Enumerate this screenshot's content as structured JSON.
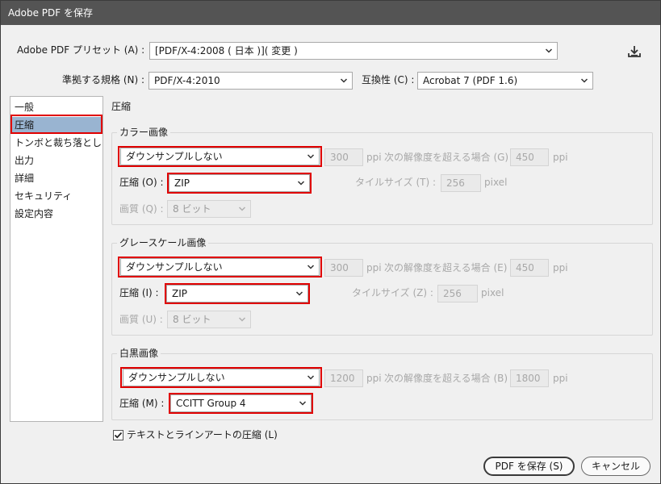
{
  "window": {
    "title": "Adobe PDF を保存"
  },
  "preset": {
    "label": "Adobe PDF プリセット (A) :",
    "value": "[PDF/X-4:2008 ( 日本 )]( 変更 )"
  },
  "standard": {
    "label": "準拠する規格 (N) :",
    "value": "PDF/X-4:2010"
  },
  "compat": {
    "label": "互換性 (C) :",
    "value": "Acrobat 7 (PDF 1.6)"
  },
  "sidebar": {
    "items": [
      {
        "label": "一般"
      },
      {
        "label": "圧縮"
      },
      {
        "label": "トンボと裁ち落とし"
      },
      {
        "label": "出力"
      },
      {
        "label": "詳細"
      },
      {
        "label": "セキュリティ"
      },
      {
        "label": "設定内容"
      }
    ],
    "selected": "圧縮"
  },
  "section_title": "圧縮",
  "color": {
    "title": "カラー画像",
    "downsample": "ダウンサンプルしない",
    "ppi_value": "300",
    "ppi_label": "ppi",
    "above_label": "次の解像度を超える場合 (G)",
    "above_value": "450",
    "above_unit": "ppi",
    "compression_label": "圧縮 (O) :",
    "compression": "ZIP",
    "tile_label": "タイルサイズ (T) :",
    "tile_value": "256",
    "tile_unit": "pixel",
    "quality_label": "画質 (Q) :",
    "quality": "8 ビット"
  },
  "gray": {
    "title": "グレースケール画像",
    "downsample": "ダウンサンプルしない",
    "ppi_value": "300",
    "ppi_label": "ppi",
    "above_label": "次の解像度を超える場合 (E)",
    "above_value": "450",
    "above_unit": "ppi",
    "compression_label": "圧縮 (I) :",
    "compression": "ZIP",
    "tile_label": "タイルサイズ (Z) :",
    "tile_value": "256",
    "tile_unit": "pixel",
    "quality_label": "画質 (U) :",
    "quality": "8 ビット"
  },
  "mono": {
    "title": "白黒画像",
    "downsample": "ダウンサンプルしない",
    "ppi_value": "1200",
    "ppi_label": "ppi",
    "above_label": "次の解像度を超える場合 (B)",
    "above_value": "1800",
    "above_unit": "ppi",
    "compression_label": "圧縮 (M) :",
    "compression": "CCITT Group 4"
  },
  "text_compress": {
    "label": "テキストとラインアートの圧縮 (L)",
    "checked": true
  },
  "buttons": {
    "save": "PDF を保存 (S)",
    "cancel": "キャンセル"
  },
  "icons": {
    "save_preset": "save-preset-icon",
    "dropdown": "chevron-down-icon",
    "check": "checkmark-icon"
  },
  "colors": {
    "highlight": "#e00000",
    "selection": "#99b4d1",
    "titlebar": "#545454"
  }
}
